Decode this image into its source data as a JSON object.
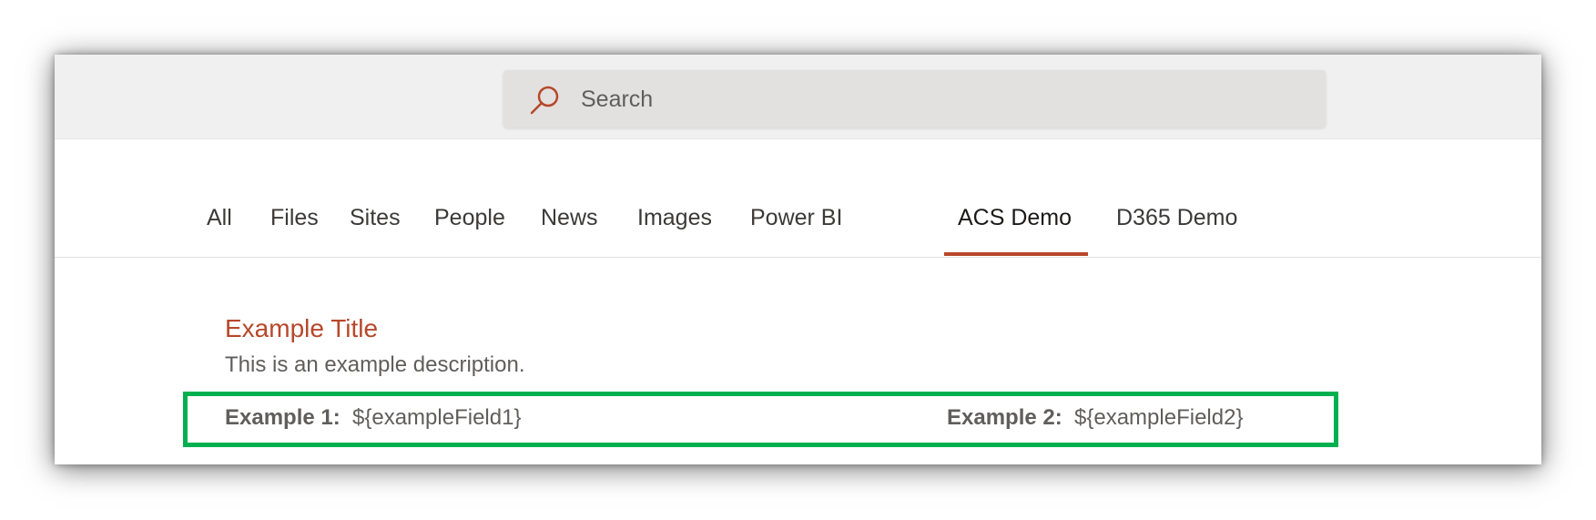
{
  "search": {
    "placeholder": "Search",
    "icon": "search-icon"
  },
  "tabs": [
    {
      "label": "All"
    },
    {
      "label": "Files"
    },
    {
      "label": "Sites"
    },
    {
      "label": "People"
    },
    {
      "label": "News"
    },
    {
      "label": "Images"
    },
    {
      "label": "Power BI"
    },
    {
      "label": "ACS Demo",
      "active": true
    },
    {
      "label": "D365 Demo"
    }
  ],
  "result": {
    "title": "Example Title",
    "description": "This is an example description.",
    "fields": [
      {
        "label": "Example 1:",
        "value": "${exampleField1}"
      },
      {
        "label": "Example 2:",
        "value": "${exampleField2}"
      }
    ]
  },
  "colors": {
    "accent": "#b7472a",
    "highlight": "#00b050",
    "top_bar": "#f0f0f0",
    "search_box": "#e2e1df"
  }
}
